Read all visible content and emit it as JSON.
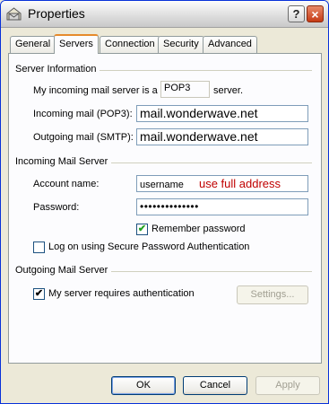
{
  "window": {
    "title": "Properties",
    "help_label": "?",
    "close_label": "×"
  },
  "tabs": [
    {
      "label": "General"
    },
    {
      "label": "Servers"
    },
    {
      "label": "Connection"
    },
    {
      "label": "Security"
    },
    {
      "label": "Advanced"
    }
  ],
  "server_info": {
    "heading": "Server Information",
    "incoming_prefix": "My incoming mail server is a",
    "server_type": "POP3",
    "incoming_suffix": "server.",
    "incoming_label": "Incoming mail (POP3):",
    "incoming_value": "mail.wonderwave.net",
    "outgoing_label": "Outgoing mail (SMTP):",
    "outgoing_value": "mail.wonderwave.net"
  },
  "incoming_server": {
    "heading": "Incoming Mail Server",
    "account_label": "Account name:",
    "account_value": "username",
    "account_hint": "use full address",
    "password_label": "Password:",
    "password_value": "••••••••••••••",
    "remember_label": "Remember password",
    "remember_checked": true,
    "spa_label": "Log on using Secure Password Authentication",
    "spa_checked": false
  },
  "outgoing_server": {
    "heading": "Outgoing Mail Server",
    "auth_label": "My server requires authentication",
    "auth_checked": true,
    "settings_label": "Settings..."
  },
  "buttons": {
    "ok": "OK",
    "cancel": "Cancel",
    "apply": "Apply"
  }
}
